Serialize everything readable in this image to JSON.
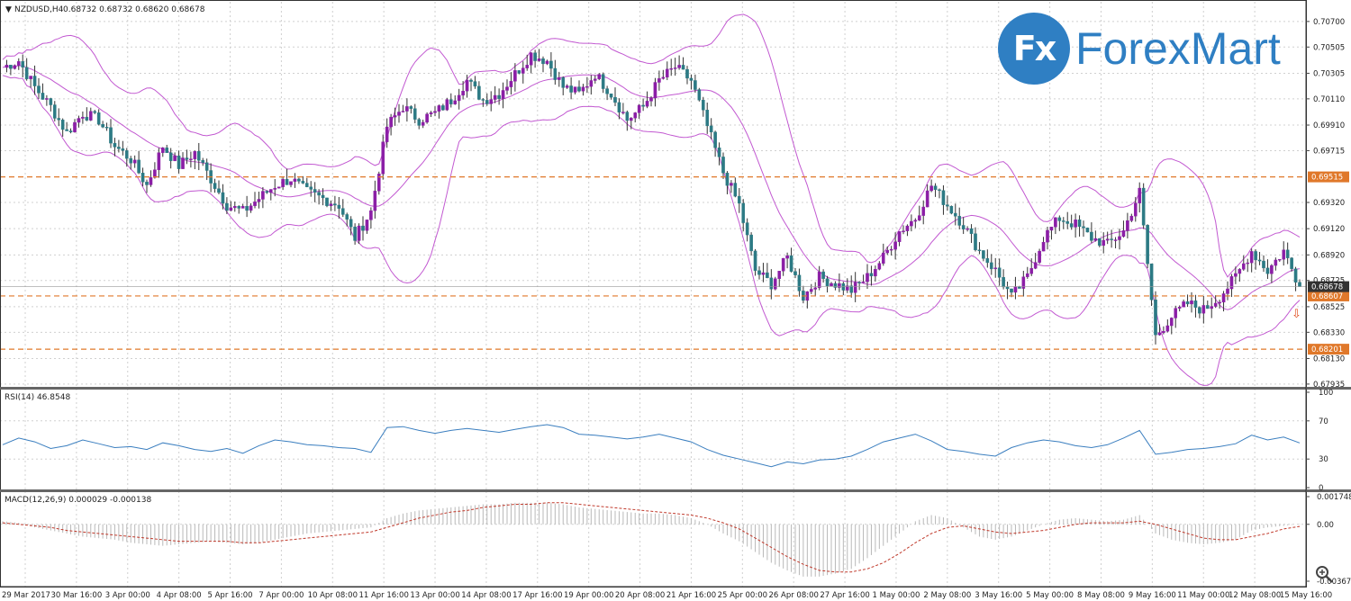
{
  "chart_header": {
    "title": "NZDUSD,H4",
    "ohlc": "0.68732 0.68732 0.68620 0.68678"
  },
  "logo": {
    "mark": "Fx",
    "name": "ForexMart",
    "icon": "fx-arrow-logo-icon"
  },
  "colors": {
    "bull": "#8b1ea6",
    "bear": "#2c7a84",
    "bands": "#c259d1",
    "level_line": "#e0782a",
    "level_label_bg": "#e0782a",
    "price_label_bg": "#333333",
    "rsi": "#3a7ebf",
    "macd_hist": "#b8b8b8",
    "macd_signal": "#c0392b",
    "grid": "#d0d0d0",
    "axis_text": "#222222"
  },
  "chart_data": [
    {
      "type": "candlestick",
      "panel": "main",
      "symbol": "NZDUSD",
      "timeframe": "H4",
      "header": "NZDUSD,H4  0.68732 0.68732 0.68620 0.68678",
      "indicator": "Bollinger Bands",
      "ylim": [
        0.679,
        0.7085
      ],
      "y_ticks": [
        0.707,
        0.70505,
        0.70305,
        0.7011,
        0.6991,
        0.69715,
        0.6932,
        0.6912,
        0.6892,
        0.68725,
        0.68525,
        0.6833,
        0.6813,
        0.67935
      ],
      "y_tick_labels": [
        "0.70700",
        "0.70505",
        "0.70305",
        "0.70110",
        "0.69910",
        "0.69715",
        "0.69320",
        "0.69120",
        "0.68920",
        "0.68725",
        "0.68525",
        "0.68330",
        "0.68130",
        "0.67935"
      ],
      "current_price": 0.68678,
      "current_price_label": "0.68678",
      "levels": [
        {
          "value": 0.69515,
          "label": "0.69515"
        },
        {
          "value": 0.68607,
          "label": "0.68607"
        },
        {
          "value": 0.68201,
          "label": "0.68201"
        }
      ],
      "x_labels": [
        "29 Mar 2017",
        "30 Mar 16:00",
        "3 Apr 00:00",
        "4 Apr 08:00",
        "5 Apr 16:00",
        "7 Apr 00:00",
        "10 Apr 08:00",
        "11 Apr 16:00",
        "13 Apr 00:00",
        "14 Apr 08:00",
        "17 Apr 16:00",
        "19 Apr 00:00",
        "20 Apr 08:00",
        "21 Apr 16:00",
        "25 Apr 00:00",
        "26 Apr 08:00",
        "27 Apr 16:00",
        "1 May 00:00",
        "2 May 08:00",
        "3 May 16:00",
        "5 May 00:00",
        "8 May 08:00",
        "9 May 16:00",
        "11 May 00:00",
        "12 May 08:00",
        "15 May 16:00"
      ],
      "close_path": [
        [
          0,
          0.7035
        ],
        [
          4,
          0.704
        ],
        [
          8,
          0.702
        ],
        [
          12,
          0.7005
        ],
        [
          16,
          0.6985
        ],
        [
          20,
          0.7
        ],
        [
          24,
          0.6995
        ],
        [
          28,
          0.6975
        ],
        [
          32,
          0.6965
        ],
        [
          36,
          0.6945
        ],
        [
          40,
          0.6975
        ],
        [
          44,
          0.696
        ],
        [
          48,
          0.697
        ],
        [
          52,
          0.695
        ],
        [
          56,
          0.693
        ],
        [
          60,
          0.6925
        ],
        [
          64,
          0.6935
        ],
        [
          68,
          0.6945
        ],
        [
          72,
          0.695
        ],
        [
          76,
          0.694
        ],
        [
          80,
          0.6935
        ],
        [
          84,
          0.693
        ],
        [
          88,
          0.6905
        ],
        [
          92,
          0.6925
        ],
        [
          96,
          0.699
        ],
        [
          100,
          0.7005
        ],
        [
          104,
          0.6995
        ],
        [
          108,
          0.7
        ],
        [
          112,
          0.701
        ],
        [
          116,
          0.7025
        ],
        [
          120,
          0.701
        ],
        [
          124,
          0.7015
        ],
        [
          128,
          0.703
        ],
        [
          132,
          0.7045
        ],
        [
          136,
          0.704
        ],
        [
          140,
          0.702
        ],
        [
          144,
          0.7015
        ],
        [
          148,
          0.703
        ],
        [
          152,
          0.7015
        ],
        [
          156,
          0.6995
        ],
        [
          160,
          0.7005
        ],
        [
          164,
          0.7025
        ],
        [
          168,
          0.7035
        ],
        [
          172,
          0.7025
        ],
        [
          176,
          0.699
        ],
        [
          180,
          0.6955
        ],
        [
          184,
          0.693
        ],
        [
          188,
          0.688
        ],
        [
          192,
          0.687
        ],
        [
          196,
          0.689
        ],
        [
          200,
          0.686
        ],
        [
          204,
          0.6875
        ],
        [
          208,
          0.687
        ],
        [
          212,
          0.6865
        ],
        [
          216,
          0.6875
        ],
        [
          220,
          0.689
        ],
        [
          224,
          0.691
        ],
        [
          228,
          0.692
        ],
        [
          232,
          0.6945
        ],
        [
          236,
          0.693
        ],
        [
          240,
          0.6915
        ],
        [
          244,
          0.6895
        ],
        [
          248,
          0.688
        ],
        [
          252,
          0.686
        ],
        [
          256,
          0.6875
        ],
        [
          260,
          0.6905
        ],
        [
          264,
          0.692
        ],
        [
          268,
          0.6915
        ],
        [
          272,
          0.6905
        ],
        [
          276,
          0.69
        ],
        [
          280,
          0.691
        ],
        [
          284,
          0.694
        ],
        [
          288,
          0.683
        ],
        [
          292,
          0.6845
        ],
        [
          296,
          0.6855
        ],
        [
          300,
          0.685
        ],
        [
          304,
          0.686
        ],
        [
          308,
          0.6875
        ],
        [
          312,
          0.6895
        ],
        [
          316,
          0.688
        ],
        [
          320,
          0.6895
        ],
        [
          324,
          0.6868
        ]
      ]
    },
    {
      "type": "line",
      "panel": "rsi",
      "title": "RSI(14) 46.8548",
      "ylim": [
        0,
        100
      ],
      "y_ticks": [
        100,
        70,
        30,
        0
      ],
      "y_tick_labels": [
        "100",
        "70",
        "30",
        "0"
      ],
      "current_value": 46.8548,
      "values": [
        45,
        52,
        48,
        41,
        44,
        50,
        46,
        42,
        43,
        40,
        47,
        44,
        40,
        38,
        41,
        36,
        44,
        50,
        48,
        45,
        44,
        42,
        41,
        37,
        63,
        64,
        60,
        57,
        60,
        62,
        60,
        58,
        61,
        64,
        66,
        63,
        56,
        55,
        53,
        51,
        53,
        56,
        52,
        48,
        40,
        34,
        30,
        26,
        22,
        27,
        25,
        29,
        30,
        33,
        40,
        48,
        52,
        56,
        49,
        40,
        38,
        35,
        33,
        42,
        47,
        50,
        48,
        44,
        42,
        45,
        52,
        60,
        35,
        37,
        40,
        41,
        43,
        46,
        55,
        50,
        53,
        46.85
      ]
    },
    {
      "type": "bar",
      "panel": "macd",
      "title": "MACD(12,26,9) 0.000029 -0.000138",
      "y_tick_labels": [
        "0.001748",
        "0.00",
        "-0.003673"
      ],
      "ylim": [
        -0.0037,
        0.0018
      ],
      "histogram": [
        0.0002,
        0.0001,
        -0.0002,
        -0.0004,
        -0.0006,
        -0.0008,
        -0.0009,
        -0.001,
        -0.0012,
        -0.0013,
        -0.0014,
        -0.0013,
        -0.0012,
        -0.0011,
        -0.0012,
        -0.0013,
        -0.0012,
        -0.001,
        -0.0008,
        -0.0006,
        -0.0005,
        -0.0004,
        -0.0003,
        -0.0002,
        0.0004,
        0.0007,
        0.0009,
        0.001,
        0.0011,
        0.0012,
        0.0013,
        0.0013,
        0.0014,
        0.0014,
        0.0014,
        0.0013,
        0.0011,
        0.001,
        0.0009,
        0.0008,
        0.0007,
        0.0007,
        0.0006,
        0.0004,
        0.0,
        -0.0006,
        -0.0011,
        -0.0018,
        -0.0025,
        -0.003,
        -0.0034,
        -0.0034,
        -0.0032,
        -0.0029,
        -0.0022,
        -0.0014,
        -0.0006,
        0.0002,
        0.0006,
        0.0004,
        -0.0002,
        -0.0008,
        -0.001,
        -0.0008,
        -0.0004,
        0.0,
        0.0003,
        0.0004,
        0.0003,
        0.0002,
        0.0003,
        0.0006,
        -0.0006,
        -0.001,
        -0.0012,
        -0.0013,
        -0.0012,
        -0.001,
        -0.0004,
        -0.0002,
        -0.0001,
        3e-05
      ],
      "signal": [
        0.0001,
        0.0,
        -0.0001,
        -0.0002,
        -0.0004,
        -0.0005,
        -0.0006,
        -0.0007,
        -0.0008,
        -0.0009,
        -0.001,
        -0.0011,
        -0.0011,
        -0.0011,
        -0.0011,
        -0.0012,
        -0.0012,
        -0.0011,
        -0.001,
        -0.0009,
        -0.0008,
        -0.0007,
        -0.0006,
        -0.0005,
        -0.0002,
        0.0001,
        0.0004,
        0.0006,
        0.0008,
        0.0009,
        0.0011,
        0.0012,
        0.0013,
        0.0013,
        0.0014,
        0.0014,
        0.0013,
        0.0012,
        0.0011,
        0.001,
        0.0009,
        0.0008,
        0.0007,
        0.0006,
        0.0004,
        0.0001,
        -0.0003,
        -0.0009,
        -0.0015,
        -0.0021,
        -0.0026,
        -0.003,
        -0.0031,
        -0.0031,
        -0.0029,
        -0.0025,
        -0.0019,
        -0.0012,
        -0.0006,
        -0.0002,
        -0.0001,
        -0.0003,
        -0.0005,
        -0.0006,
        -0.0005,
        -0.0004,
        -0.0002,
        0.0,
        0.0001,
        0.0001,
        0.0001,
        0.0002,
        0.0,
        -0.0003,
        -0.0006,
        -0.0009,
        -0.001,
        -0.001,
        -0.0008,
        -0.0006,
        -0.0003,
        -0.000138
      ]
    }
  ]
}
